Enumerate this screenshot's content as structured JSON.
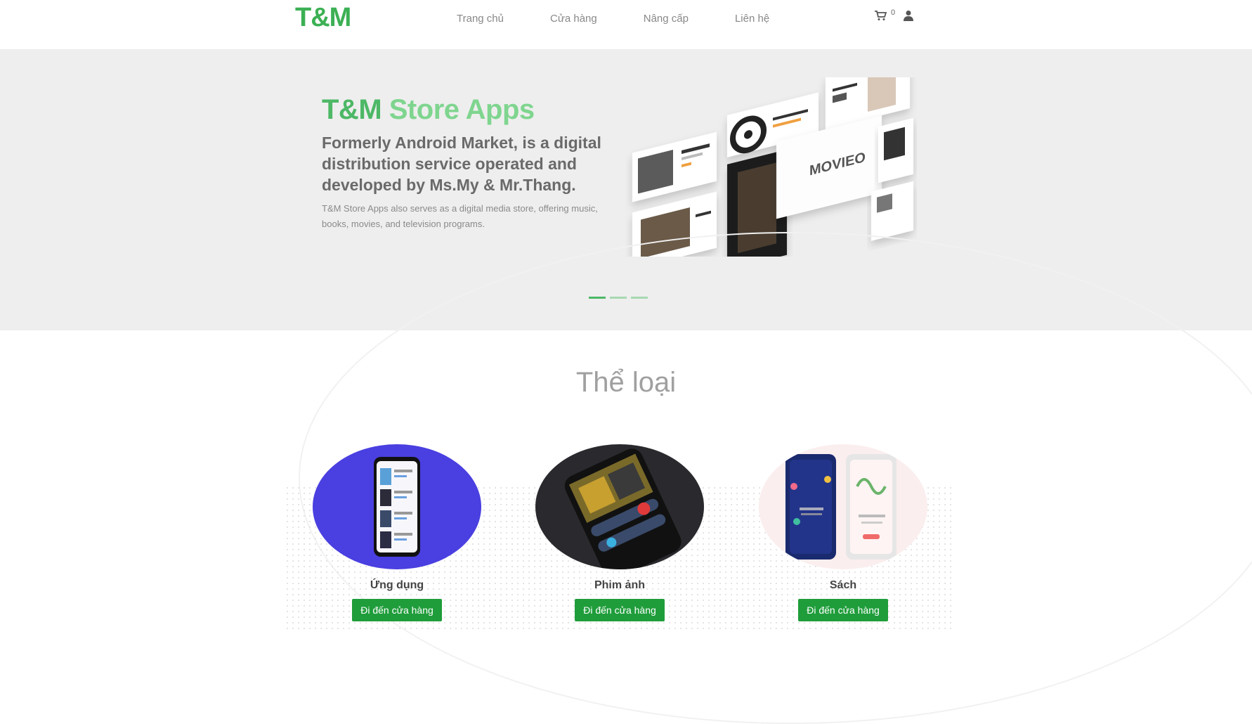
{
  "header": {
    "logo": "T&M",
    "nav": [
      "Trang chủ",
      "Cửa hàng",
      "Nâng cấp",
      "Liên hệ"
    ],
    "cart_count": "0"
  },
  "hero": {
    "title_brand": "T&M",
    "title_rest": " Store Apps",
    "headline": "Formerly Android Market, is a digital distribution service operated and developed by Ms.My & Mr.Thang.",
    "description": "T&M Store Apps also serves as a digital media store, offering music, books, movies, and television programs.",
    "image_word": "MOVIEO",
    "slides": 3,
    "active_slide": 1
  },
  "categories": {
    "title": "Thể loại",
    "items": [
      {
        "name": "Ứng dụng",
        "button": "Đi đến cửa hàng"
      },
      {
        "name": "Phim ảnh",
        "button": "Đi đến cửa hàng"
      },
      {
        "name": "Sách",
        "button": "Đi đến cửa hàng"
      }
    ]
  },
  "colors": {
    "brand": "#3cb054",
    "button": "#1f9d3b",
    "hero_bg": "#eeeeee"
  }
}
